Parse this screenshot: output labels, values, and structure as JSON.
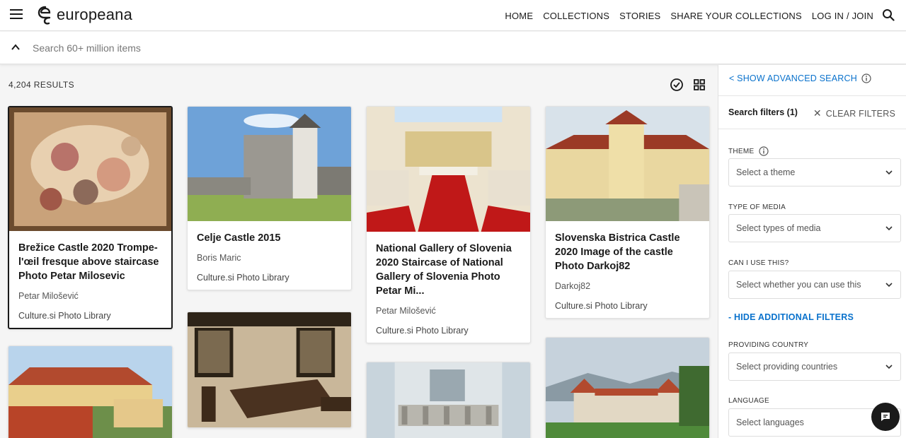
{
  "header": {
    "logo_text": "europeana",
    "nav": [
      "HOME",
      "COLLECTIONS",
      "STORIES",
      "SHARE YOUR COLLECTIONS",
      "LOG IN / JOIN"
    ]
  },
  "search": {
    "placeholder": "Search 60+ million items"
  },
  "results": {
    "count": "4,204 RESULTS"
  },
  "cards": [
    {
      "title": "Brežice Castle 2020 Trompe-l'œil fresque above staircase Photo Petar Milosevic",
      "creator": "Petar Milošević",
      "provider": "Culture.si Photo Library"
    },
    {
      "title": "Celje Castle 2015",
      "creator": "Boris Maric",
      "provider": "Culture.si Photo Library"
    },
    {
      "title": "National Gallery of Slovenia 2020 Staircase of National Gallery of Slovenia Photo Petar Mi...",
      "creator": "Petar Milošević",
      "provider": "Culture.si Photo Library"
    },
    {
      "title": "Slovenska Bistrica Castle 2020 Image of the castle Photo Darkoj82",
      "creator": "Darkoj82",
      "provider": "Culture.si Photo Library"
    }
  ],
  "sidebar": {
    "advanced_search": "< SHOW ADVANCED SEARCH",
    "filters_label": "Search filters (1)",
    "clear_filters": "CLEAR FILTERS",
    "theme_label": "THEME",
    "theme_placeholder": "Select a theme",
    "media_label": "TYPE OF MEDIA",
    "media_placeholder": "Select types of media",
    "reuse_label": "CAN I USE THIS?",
    "reuse_placeholder": "Select whether you can use this",
    "hide_filters": "- HIDE ADDITIONAL FILTERS",
    "country_label": "PROVIDING COUNTRY",
    "country_placeholder": "Select providing countries",
    "language_label": "LANGUAGE",
    "language_placeholder": "Select languages"
  },
  "colors": {
    "link": "#0a72cc",
    "text": "#1a1a1a"
  }
}
